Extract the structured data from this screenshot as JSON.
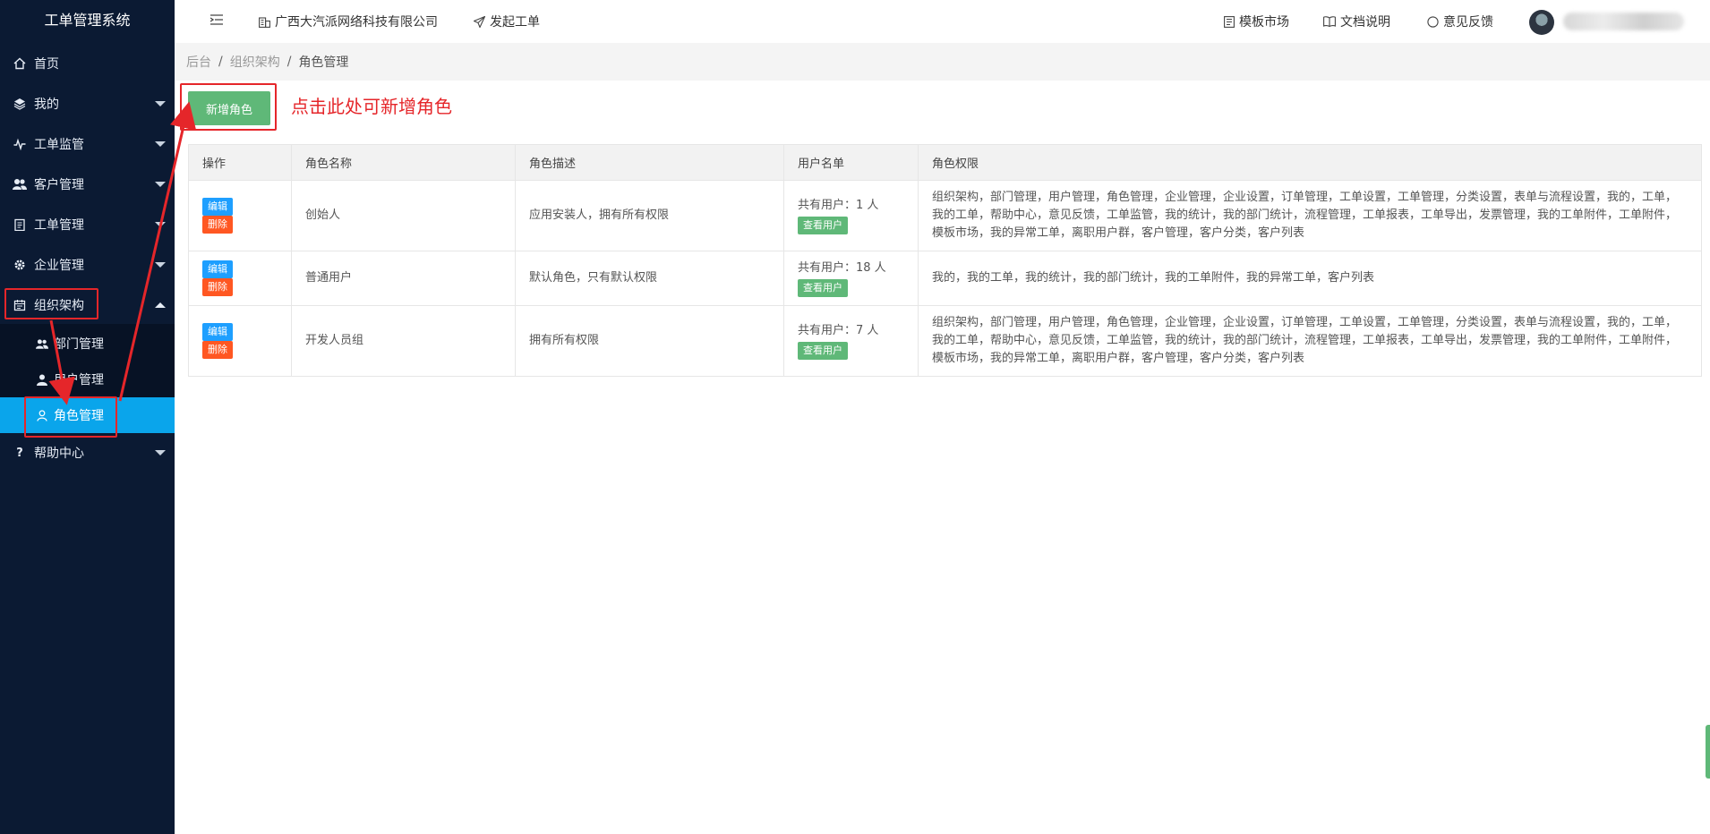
{
  "app": {
    "title": "工单管理系统"
  },
  "sidebar": {
    "items": [
      {
        "label": "首页",
        "icon": "home-icon"
      },
      {
        "label": "我的",
        "icon": "layers-icon"
      },
      {
        "label": "工单监管",
        "icon": "pulse-icon"
      },
      {
        "label": "客户管理",
        "icon": "users-icon"
      },
      {
        "label": "工单管理",
        "icon": "clipboard-icon"
      },
      {
        "label": "企业管理",
        "icon": "gear-icon"
      },
      {
        "label": "组织架构",
        "icon": "calendar-icon"
      },
      {
        "label": "帮助中心",
        "icon": "question-icon"
      }
    ],
    "sub_items": [
      {
        "label": "部门管理",
        "icon": "group-icon"
      },
      {
        "label": "用户管理",
        "icon": "user-icon"
      },
      {
        "label": "角色管理",
        "icon": "person-outline-icon"
      }
    ]
  },
  "header": {
    "company": "广西大汽派网络科技有限公司",
    "launch": "发起工单",
    "template_market": "模板市场",
    "docs": "文档说明",
    "feedback": "意见反馈"
  },
  "breadcrumb": [
    "后台",
    "组织架构",
    "角色管理"
  ],
  "toolbar": {
    "add_label": "新增角色",
    "annotation": "点击此处可新增角色"
  },
  "table": {
    "headers": [
      "操作",
      "角色名称",
      "角色描述",
      "用户名单",
      "角色权限"
    ],
    "edit_label": "编辑",
    "delete_label": "删除",
    "view_users_label": "查看用户",
    "rows": [
      {
        "name": "创始人",
        "desc": "应用安装人，拥有所有权限",
        "users": "共有用户：1 人",
        "perms": "组织架构，部门管理，用户管理，角色管理，企业管理，企业设置，订单管理，工单设置，工单管理，分类设置，表单与流程设置，我的，工单，我的工单，帮助中心，意见反馈，工单监管，我的统计，我的部门统计，流程管理，工单报表，工单导出，发票管理，我的工单附件，工单附件，模板市场，我的异常工单，离职用户群，客户管理，客户分类，客户列表"
      },
      {
        "name": "普通用户",
        "desc": "默认角色，只有默认权限",
        "users": "共有用户：18 人",
        "perms": "我的，我的工单，我的统计，我的部门统计，我的工单附件，我的异常工单，客户列表"
      },
      {
        "name": "开发人员组",
        "desc": "拥有所有权限",
        "users": "共有用户：7 人",
        "perms": "组织架构，部门管理，用户管理，角色管理，企业管理，企业设置，订单管理，工单设置，工单管理，分类设置，表单与流程设置，我的，工单，我的工单，帮助中心，意见反馈，工单监管，我的统计，我的部门统计，流程管理，工单报表，工单导出，发票管理，我的工单附件，工单附件，模板市场，我的异常工单，离职用户群，客户管理，客户分类，客户列表"
      }
    ]
  },
  "colors": {
    "sidebar_bg": "#0b1a33",
    "active": "#0aa5eb",
    "add_button": "#5fb878",
    "edit_tag": "#1e9fff",
    "delete_tag": "#ff5722",
    "annotation": "#e5262a"
  }
}
